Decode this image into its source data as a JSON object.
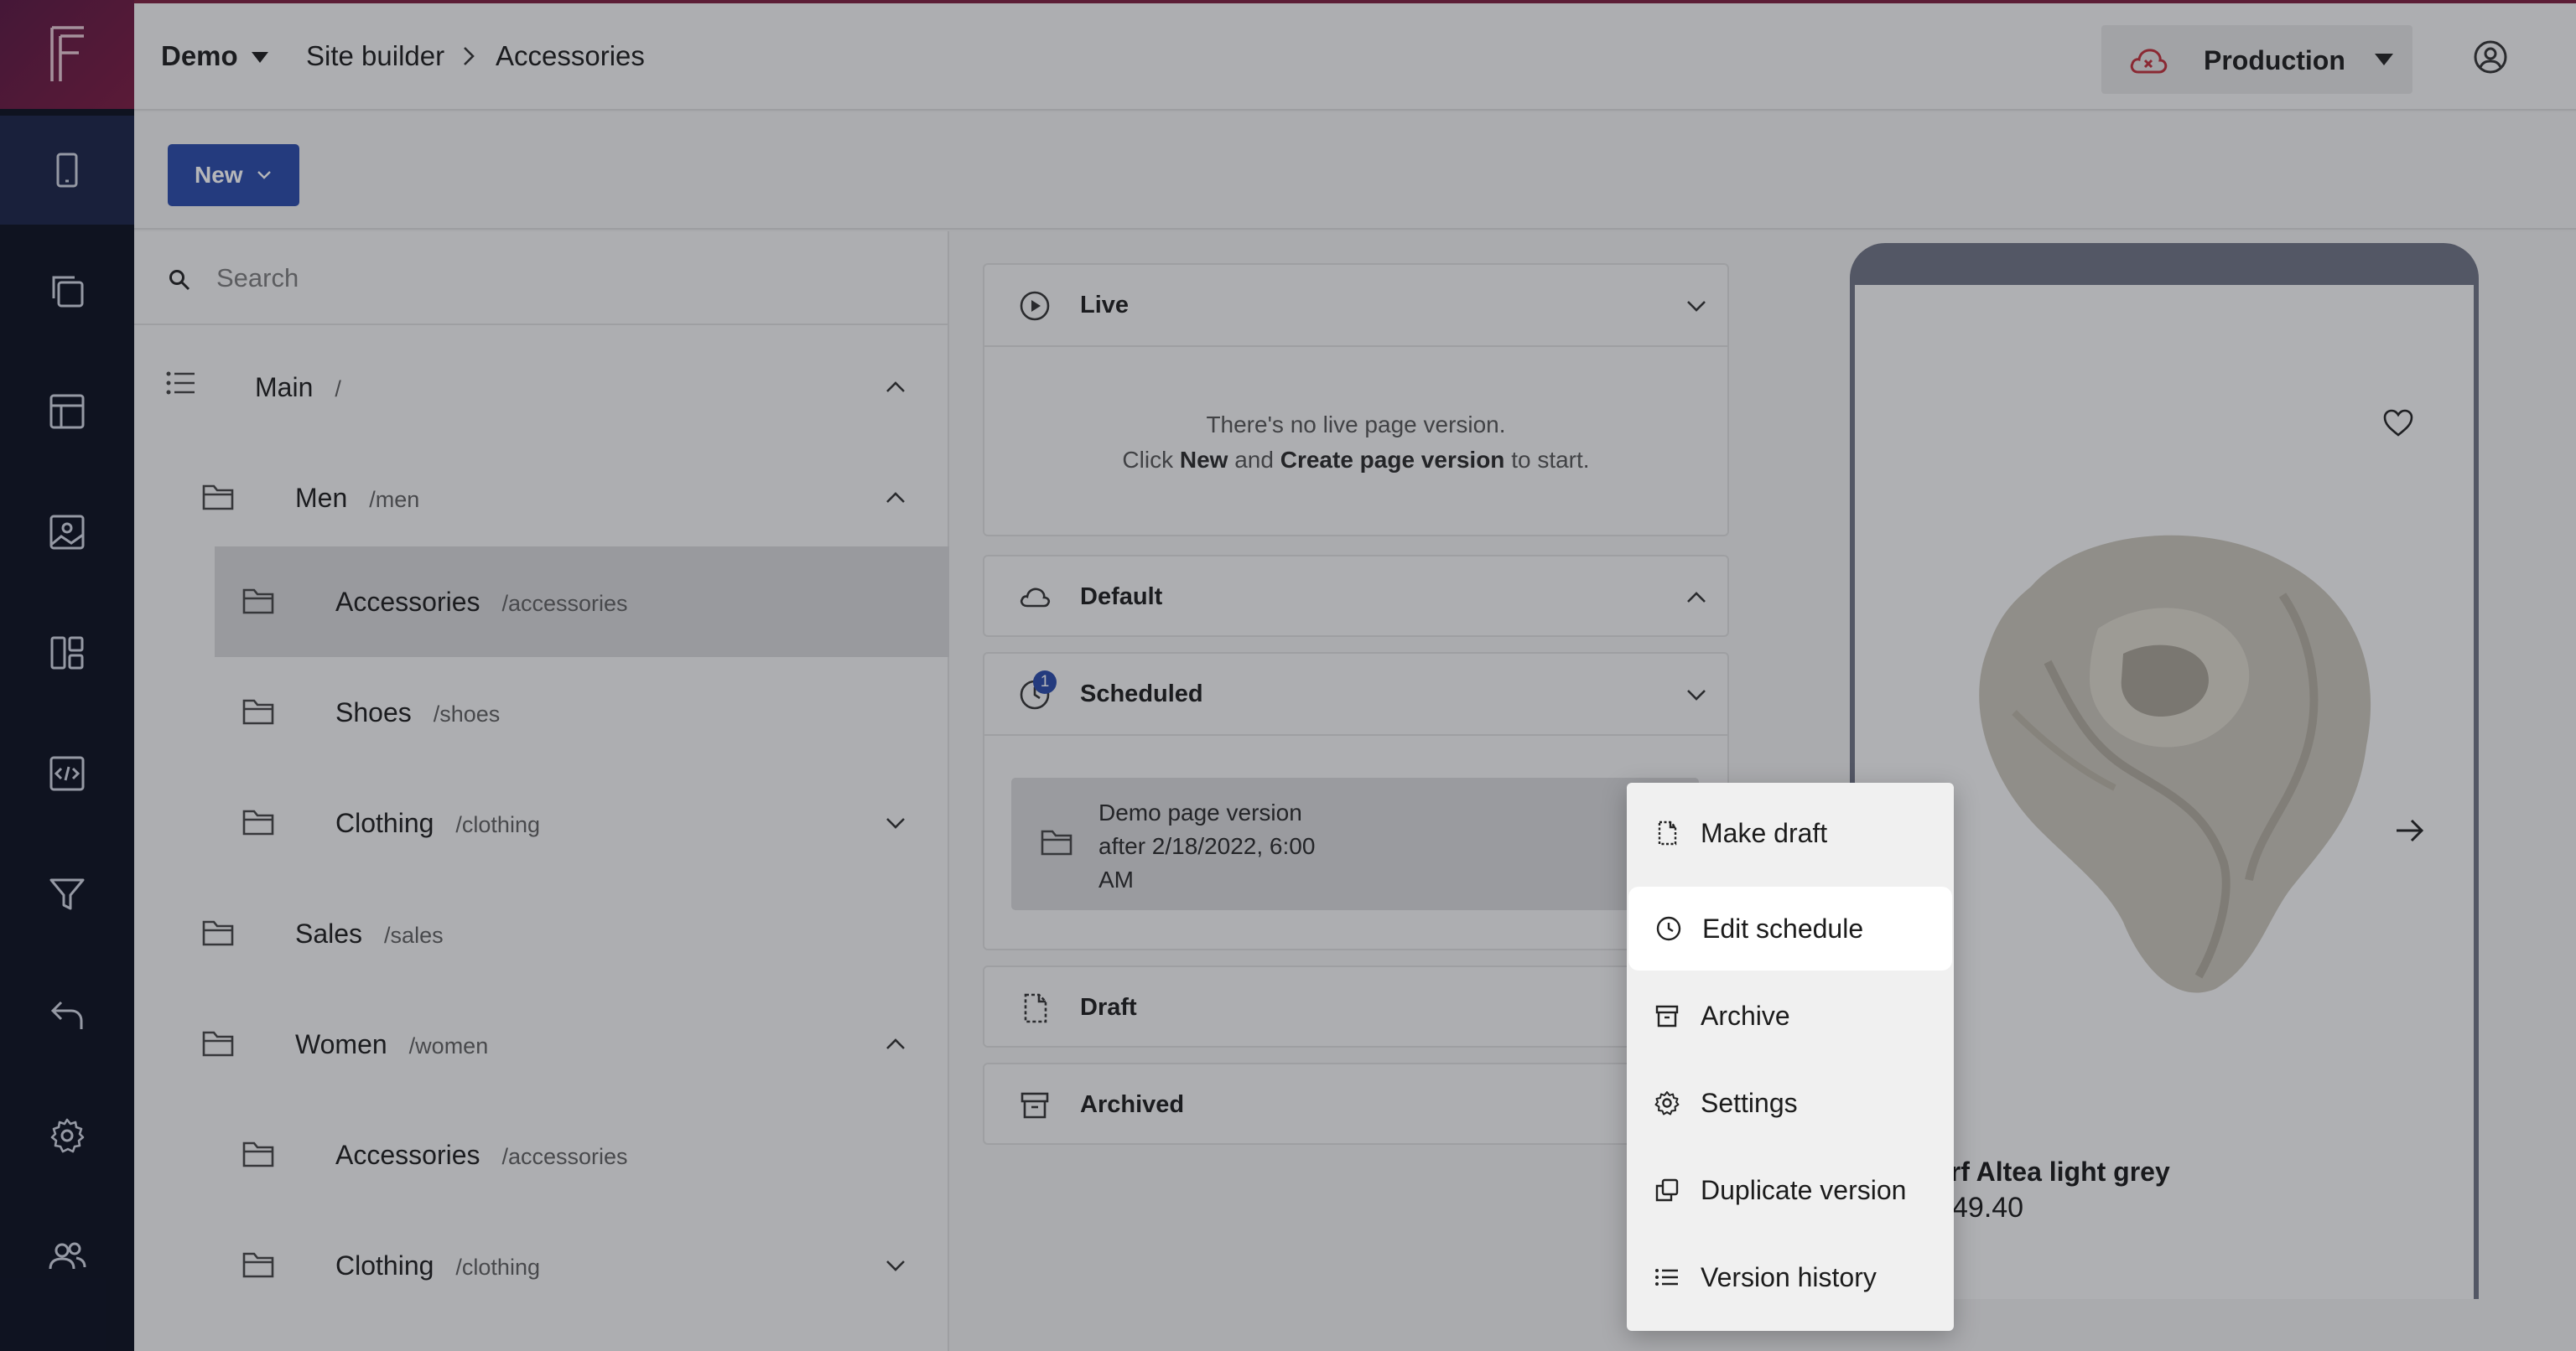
{
  "app": {
    "logo_letter": "F"
  },
  "breadcrumb": {
    "project": "Demo",
    "section": "Site builder",
    "page": "Accessories"
  },
  "environment": {
    "label": "Production"
  },
  "toolbar": {
    "new_label": "New"
  },
  "search": {
    "placeholder": "Search"
  },
  "tree": {
    "items": [
      {
        "name": "Main",
        "path": "/"
      },
      {
        "name": "Men",
        "path": "/men"
      },
      {
        "name": "Accessories",
        "path": "/accessories"
      },
      {
        "name": "Shoes",
        "path": "/shoes"
      },
      {
        "name": "Clothing",
        "path": "/clothing"
      },
      {
        "name": "Sales",
        "path": "/sales"
      },
      {
        "name": "Women",
        "path": "/women"
      },
      {
        "name": "Accessories",
        "path": "/accessories"
      },
      {
        "name": "Clothing",
        "path": "/clothing"
      }
    ]
  },
  "versions": {
    "live": {
      "title": "Live",
      "empty_line1": "There's no live page version.",
      "click": "Click",
      "new_word": "New",
      "and": "and",
      "create_word": "Create page version",
      "to_start": "to start."
    },
    "default": {
      "title": "Default"
    },
    "scheduled": {
      "title": "Scheduled",
      "badge": "1",
      "item_line1": "Demo page version",
      "item_line2": "after 2/18/2022, 6:00",
      "item_line3": "AM"
    },
    "draft": {
      "title": "Draft"
    },
    "archived": {
      "title": "Archived"
    }
  },
  "preview": {
    "product_name": "arf Altea light grey",
    "product_price": "49.40"
  },
  "context_menu": {
    "items": [
      {
        "label": "Make draft",
        "icon": "draft-icon"
      },
      {
        "label": "Edit schedule",
        "icon": "clock-icon"
      },
      {
        "label": "Archive",
        "icon": "archive-icon"
      },
      {
        "label": "Settings",
        "icon": "gear-icon"
      },
      {
        "label": "Duplicate version",
        "icon": "duplicate-icon"
      },
      {
        "label": "Version history",
        "icon": "list-icon"
      }
    ]
  },
  "colors": {
    "brand": "#7c1f3e",
    "accent_blue": "#2a4aa8",
    "rail": "#0b0f1e",
    "env_cloud": "#c0303a"
  }
}
